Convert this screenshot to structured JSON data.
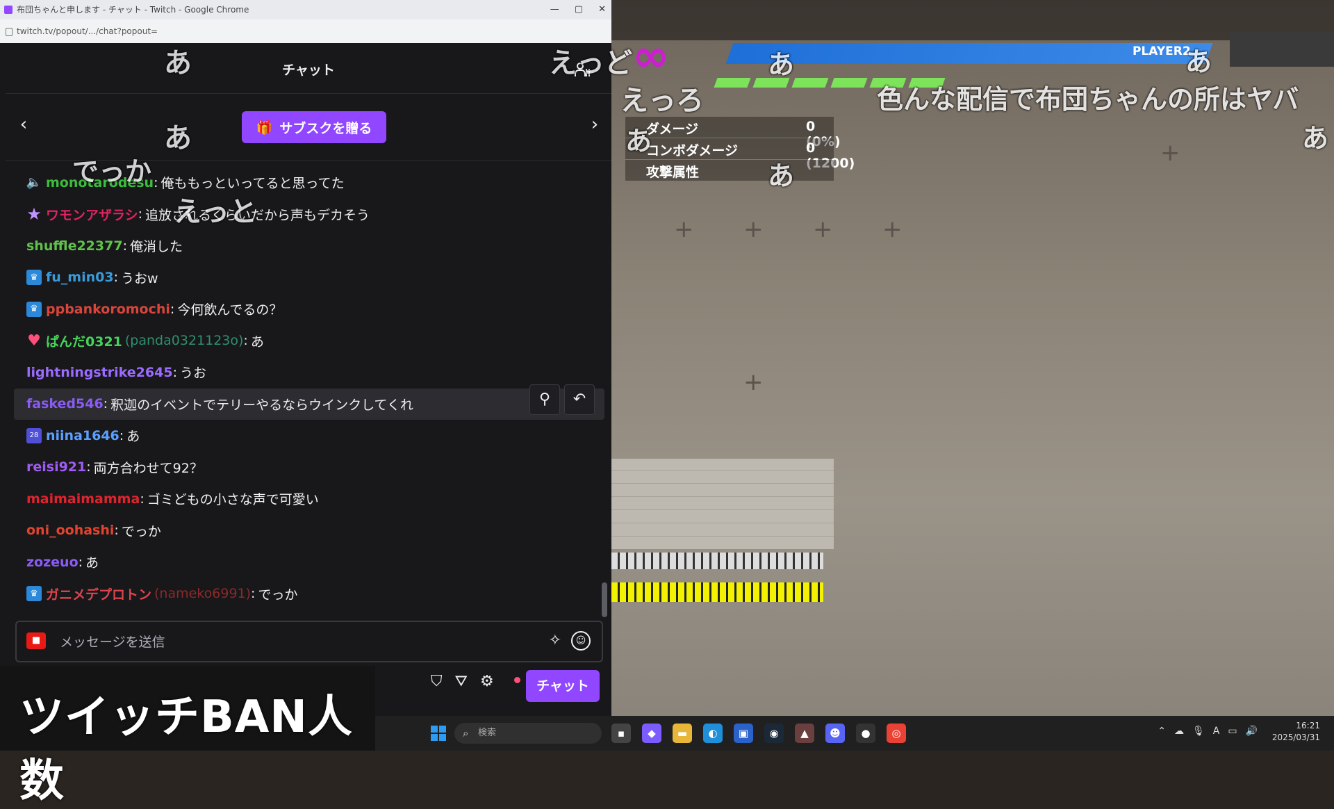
{
  "browser": {
    "title": "布団ちゃんと申します - チャット - Twitch - Google Chrome",
    "url": "twitch.tv/popout/.../chat?popout="
  },
  "chat": {
    "header_title": "チャット",
    "gift_button": "サブスクを贈る",
    "messages": [
      {
        "badge": "mute",
        "badge_icon": "🔈",
        "user": "monotarodesu",
        "color": "#3dbd3d",
        "login": "",
        "text": "俺ももっといってると思ってた"
      },
      {
        "badge": "star",
        "badge_icon": "★",
        "user": "ワモンアザラシ",
        "color": "#e0245e",
        "login": "",
        "text": "追放されるくらいだから声もデカそう"
      },
      {
        "badge": "",
        "badge_icon": "",
        "user": "shuffle22377",
        "color": "#5fc24a",
        "login": "",
        "text": "俺消した"
      },
      {
        "badge": "sub",
        "badge_icon": "♛",
        "user": "fu_min03",
        "color": "#3a9bd9",
        "login": "",
        "text": "うおw"
      },
      {
        "badge": "sub",
        "badge_icon": "♛",
        "user": "ppbankoromochi",
        "color": "#d9453a",
        "login": "",
        "text": "今何飲んでるの？"
      },
      {
        "badge": "heart",
        "badge_icon": "♥",
        "user": "ぱんだ0321",
        "color": "#45d45a",
        "login": "(panda0321123o)",
        "text": "あ"
      },
      {
        "badge": "",
        "badge_icon": "",
        "user": "lightningstrike2645",
        "color": "#9b6bff",
        "login": "",
        "text": "うお"
      },
      {
        "badge": "",
        "badge_icon": "",
        "user": "fasked546",
        "color": "#8a5cf5",
        "login": "",
        "text": "釈迦のイベントでテリーやるならウインクしてくれ"
      },
      {
        "badge": "blue",
        "badge_icon": "28",
        "user": "niina1646",
        "color": "#5aa0ff",
        "login": "",
        "text": "あ"
      },
      {
        "badge": "",
        "badge_icon": "",
        "user": "reisi921",
        "color": "#a05cf5",
        "login": "",
        "text": "両方合わせて92？"
      },
      {
        "badge": "",
        "badge_icon": "",
        "user": "maimaimamma",
        "color": "#e0242e",
        "login": "",
        "text": "ゴミどもの小さな声で可愛い"
      },
      {
        "badge": "",
        "badge_icon": "",
        "user": "oni_oohashi",
        "color": "#e0442e",
        "login": "",
        "text": "でっか"
      },
      {
        "badge": "",
        "badge_icon": "",
        "user": "zozeuo",
        "color": "#8a5cf5",
        "login": "",
        "text": "あ"
      },
      {
        "badge": "sub",
        "badge_icon": "♛",
        "user": "ガニメデプロトン",
        "color": "#e0444e",
        "login": "(nameko6991)",
        "text": "でっか"
      }
    ],
    "input_placeholder": "メッセージを送信",
    "chat_button": "チャット"
  },
  "caption": "ツイッチBAN人数",
  "game": {
    "player_name": "PLAYER2",
    "training": [
      {
        "label": "ダメージ",
        "value": "0 (0%)"
      },
      {
        "label": "コンボダメージ",
        "value": "0 (1200)"
      },
      {
        "label": "攻撃属性",
        "value": ""
      }
    ]
  },
  "danmaku": [
    {
      "text": "あ"
    },
    {
      "text": "あ"
    },
    {
      "text": "でっか"
    },
    {
      "text": "えっど"
    },
    {
      "text": "えっと"
    },
    {
      "text": "えっろ"
    },
    {
      "text": "あ"
    },
    {
      "text": "あ"
    },
    {
      "text": "あ"
    },
    {
      "text": "色んな配信で布団ちゃんの所はヤバ"
    },
    {
      "text": "あ"
    },
    {
      "text": "あ"
    }
  ],
  "taskbar": {
    "search_placeholder": "検索",
    "time": "16:21",
    "date": "2025/03/31"
  },
  "colors": {
    "twitch_purple": "#9146ff",
    "chat_bg": "#18181b"
  }
}
